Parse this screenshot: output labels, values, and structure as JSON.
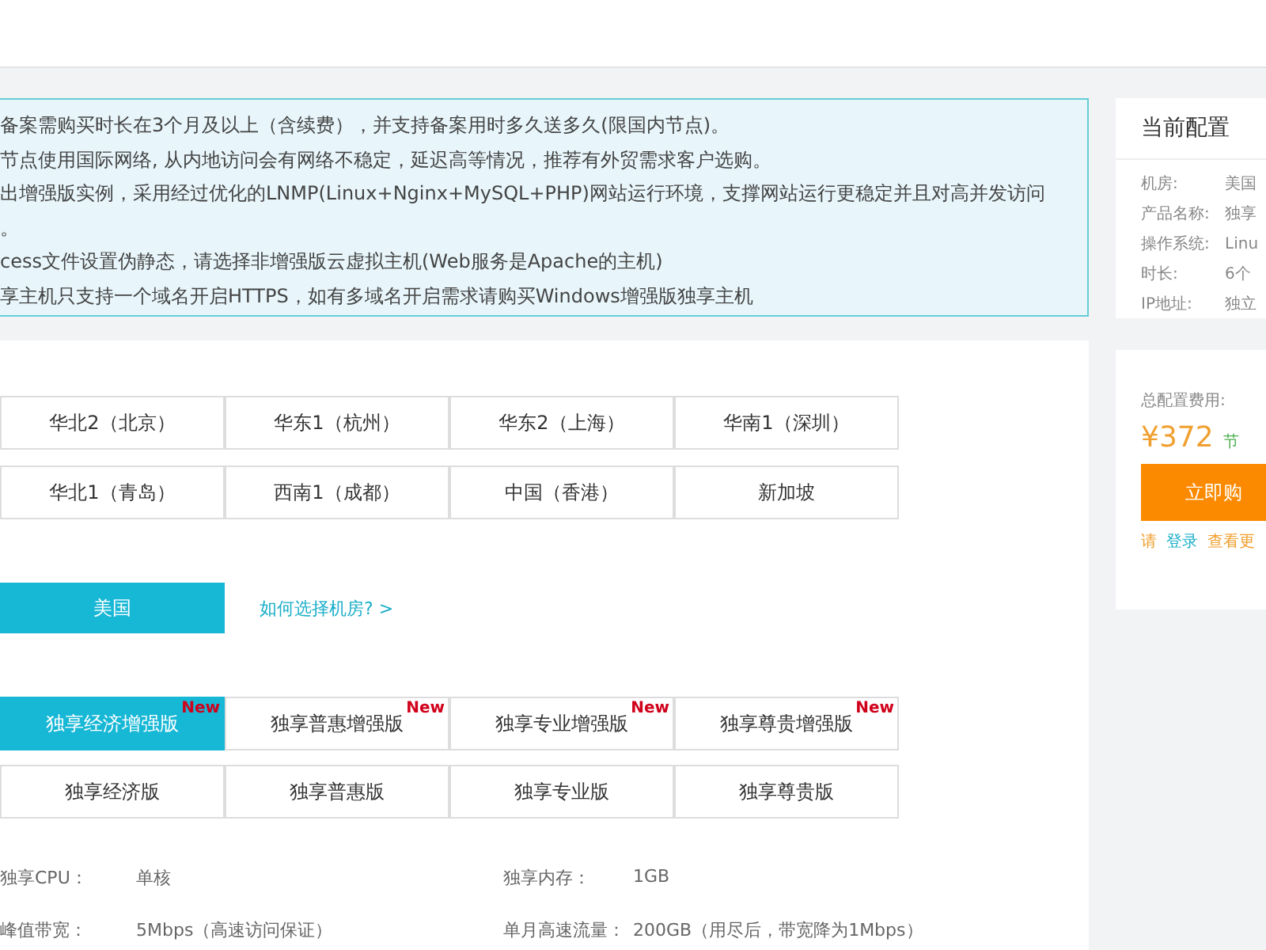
{
  "notice": {
    "lines": [
      "备案需购买时长在3个月及以上（含续费），并支持备案用时多久送多久(限国内节点)。",
      "节点使用国际网络, 从内地访问会有网络不稳定，延迟高等情况，推荐有外贸需求客户选购。",
      "出增强版实例，采用经过优化的LNMP(Linux+Nginx+MySQL+PHP)网站运行环境，支撑网站运行更稳定并且对高并发访问",
      "。",
      "cess文件设置伪静态，请选择非增强版云虚拟主机(Web服务是Apache的主机)",
      "享主机只支持一个域名开启HTTPS，如有多域名开启需求请购买Windows增强版独享主机"
    ]
  },
  "regions": [
    {
      "label": "华北2（北京）",
      "selected": false
    },
    {
      "label": "华东1（杭州）",
      "selected": false
    },
    {
      "label": "华东2（上海）",
      "selected": false
    },
    {
      "label": "华南1（深圳）",
      "selected": false
    },
    {
      "label": "华北1（青岛）",
      "selected": false
    },
    {
      "label": "西南1（成都）",
      "selected": false
    },
    {
      "label": "中国（香港）",
      "selected": false
    },
    {
      "label": "新加坡",
      "selected": false
    },
    {
      "label": "美国",
      "selected": true
    }
  ],
  "region_help_link": "如何选择机房? >",
  "editions": [
    {
      "label": "独享经济增强版",
      "badge": "New",
      "selected": true
    },
    {
      "label": "独享普惠增强版",
      "badge": "New",
      "selected": false
    },
    {
      "label": "独享专业增强版",
      "badge": "New",
      "selected": false
    },
    {
      "label": "独享尊贵增强版",
      "badge": "New",
      "selected": false
    },
    {
      "label": "独享经济版",
      "selected": false
    },
    {
      "label": "独享普惠版",
      "selected": false
    },
    {
      "label": "独享专业版",
      "selected": false
    },
    {
      "label": "独享尊贵版",
      "selected": false
    }
  ],
  "specs": [
    {
      "label": "独享CPU：",
      "value": "单核"
    },
    {
      "label": "独享内存：",
      "value": "1GB"
    },
    {
      "label": "峰值带宽：",
      "value": "5Mbps（高速访问保证）"
    },
    {
      "label": "单月高速流量：",
      "value": "200GB（用尽后，带宽降为1Mbps）"
    }
  ],
  "config": {
    "title": "当前配置",
    "items": [
      {
        "label": "机房:",
        "value": "美国"
      },
      {
        "label": "产品名称:",
        "value": "独享"
      },
      {
        "label": "操作系统:",
        "value": "Linu"
      },
      {
        "label": "时长:",
        "value": "6个"
      },
      {
        "label": "IP地址:",
        "value": "独立"
      }
    ]
  },
  "price": {
    "label": "总配置费用:",
    "amount": "¥372",
    "saving": "节",
    "buy_button": "立即购",
    "login_prefix": "请",
    "login_link": "登录",
    "more_link": "查看更"
  }
}
